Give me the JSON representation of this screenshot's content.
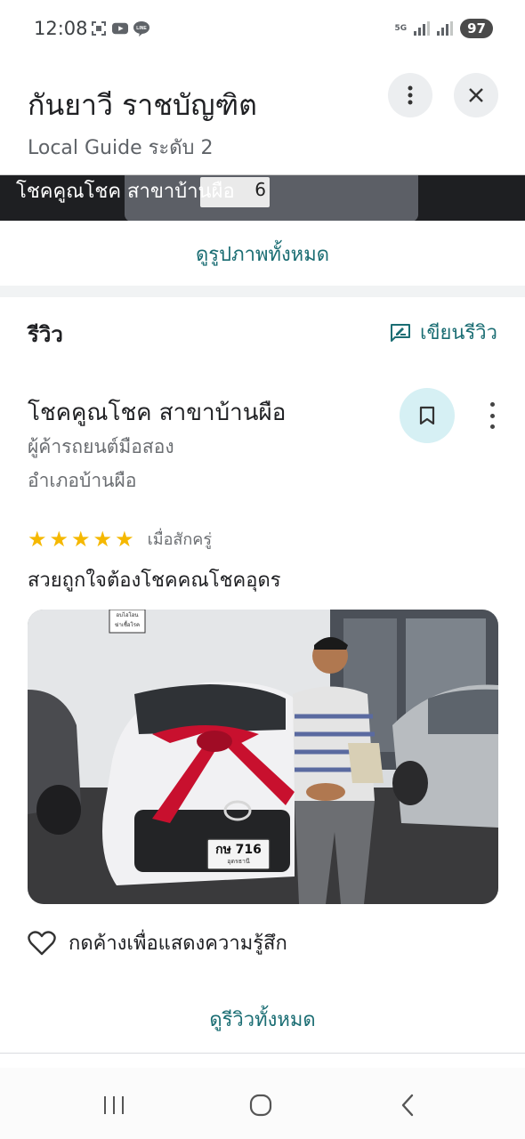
{
  "status_bar": {
    "time": "12:08",
    "network": "5G",
    "battery": "97"
  },
  "header": {
    "title": "กันยาวี ราชบัญฑิต",
    "subtitle": "Local Guide ระดับ 2"
  },
  "photo_strip": {
    "caption": "โชคคูณโชค สาขาบ้านผือ",
    "plate_digit": "6"
  },
  "view_all_photos": "ดูรูปภาพทั้งหมด",
  "reviews": {
    "heading": "รีวิว",
    "write_review": "เขียนรีวิว"
  },
  "review": {
    "place_name": "โชคคูณโชค สาขาบ้านผือ",
    "category": "ผู้ค้ารถยนต์มือสอง",
    "location": "อำเภอบ้านผือ",
    "rating": 5,
    "time": "เมื่อสักครู่",
    "text": "สวยถูกใจต้องโชคคณโชคอุดร",
    "photo": {
      "plate": "กษ 716",
      "plate_region": "อุดรธานี",
      "sign": "อบไอโอน\nฆ่าเชื้อโรค"
    },
    "reaction": "กดค้างเพื่อแสดงความรู้สึก"
  },
  "view_all_reviews": "ดูรีวิวทั้งหมด",
  "colors": {
    "accent": "#1a6d73",
    "star": "#f5b800",
    "save_bg": "#d6f0f4"
  }
}
